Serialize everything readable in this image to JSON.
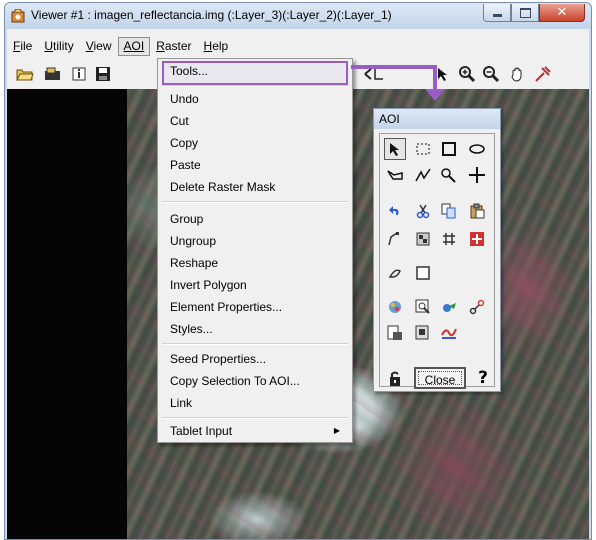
{
  "window": {
    "title": "Viewer #1 : imagen_reflectancia.img (:Layer_3)(:Layer_2)(:Layer_1)",
    "icon": "erdas-viewer-icon"
  },
  "menubar": {
    "items": [
      {
        "label": "File",
        "underline": "F",
        "rest": "ile"
      },
      {
        "label": "Utility",
        "underline": "U",
        "rest": "tility"
      },
      {
        "label": "View",
        "underline": "V",
        "rest": "iew"
      },
      {
        "label": "AOI",
        "underline": "",
        "rest": "AOI",
        "active": true
      },
      {
        "label": "Raster",
        "underline": "R",
        "rest": "aster"
      },
      {
        "label": "Help",
        "underline": "H",
        "rest": "elp"
      }
    ]
  },
  "toolbar": {
    "icons": [
      "open-folder-icon",
      "open-layer-icon",
      "info-icon",
      "save-icon",
      "select-arrow-icon",
      "zoom-in-icon",
      "zoom-out-icon",
      "pan-hand-icon",
      "inquire-cursor-icon"
    ]
  },
  "aoi_menu": {
    "highlight_color": "#9a5cc7",
    "groups": [
      [
        "Tools..."
      ],
      [
        "Undo",
        "Cut",
        "Copy",
        "Paste",
        "Delete Raster Mask"
      ],
      [
        "Group",
        "Ungroup",
        "Reshape",
        "Invert Polygon",
        "Element Properties...",
        "Styles..."
      ],
      [
        "Seed Properties...",
        "Copy Selection To AOI...",
        "Link"
      ],
      [
        "Tablet Input"
      ]
    ],
    "highlighted": "Tools...",
    "submenu_item": "Tablet Input"
  },
  "aoi_palette": {
    "title": "AOI",
    "tools": [
      "select-arrow-icon",
      "rectangle-dashed-icon",
      "rectangle-icon",
      "ellipse-icon",
      "polygon-icon",
      "polyline-icon",
      "region-grow-icon",
      "point-cross-icon",
      "undo-icon",
      "cut-icon",
      "copy-icon",
      "paste-icon",
      "reshape-icon",
      "group-icon",
      "ungroup-icon",
      "properties-icon",
      "seed-icon",
      "invert-icon",
      "styles-icon",
      "grow-properties-icon",
      "link-icon",
      "chain-icon",
      "save-aoi-icon",
      "open-aoi-icon",
      "signature-icon"
    ],
    "close_label": "Close",
    "help_label": "?"
  }
}
